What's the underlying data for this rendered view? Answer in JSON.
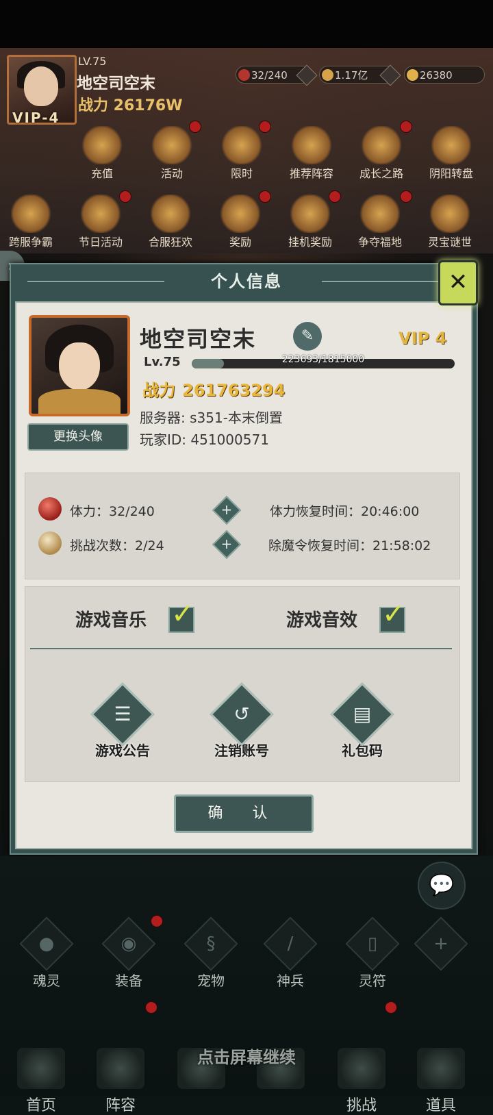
{
  "hud": {
    "level": "LV.75",
    "name": "地空司空末",
    "power": "战力 26176W",
    "vip": "VIP-4",
    "resources": [
      {
        "value": "32/240",
        "icon": "stamina-orb-icon",
        "color": "#b3362e"
      },
      {
        "value": "1.17亿",
        "icon": "coin-icon",
        "color": "#d6a24a"
      },
      {
        "value": "26380",
        "icon": "gold-ingot-icon",
        "color": "#e0b04a"
      }
    ],
    "features_row1": [
      "充值",
      "活动",
      "限时",
      "推荐阵容",
      "成长之路",
      "阴阳转盘"
    ],
    "features_row2": [
      "跨服争霸",
      "节日活动",
      "合服狂欢",
      "奖励",
      "挂机奖励",
      "争夺福地",
      "灵宝谜世"
    ]
  },
  "dialog": {
    "title": "个人信息",
    "close_label": "✕",
    "player_name": "地空司空末",
    "vip": "VIP 4",
    "level": "Lv.75",
    "exp_text": "223693/1815000",
    "exp_fraction": 0.123,
    "power_label": "战力",
    "power_value": "261763294",
    "server": "服务器: s351-本末倒置",
    "player_id": "玩家ID: 451000571",
    "change_avatar": "更换头像",
    "stamina": "体力：32/240",
    "challenges": "挑战次数：2/24",
    "stamina_recover": "体力恢复时间：20:46:00",
    "token_recover": "除魔令恢复时间：21:58:02",
    "music_label": "游戏音乐",
    "sfx_label": "游戏音效",
    "actions": [
      "游戏公告",
      "注销账号",
      "礼包码"
    ],
    "confirm": "确 认"
  },
  "bottom": {
    "skills": [
      "魂灵",
      "装备",
      "宠物",
      "神兵",
      "灵符"
    ],
    "nav": [
      "首页",
      "阵容",
      "",
      "",
      "挑战",
      "道具"
    ],
    "continue_text": "点击屏幕继续"
  }
}
